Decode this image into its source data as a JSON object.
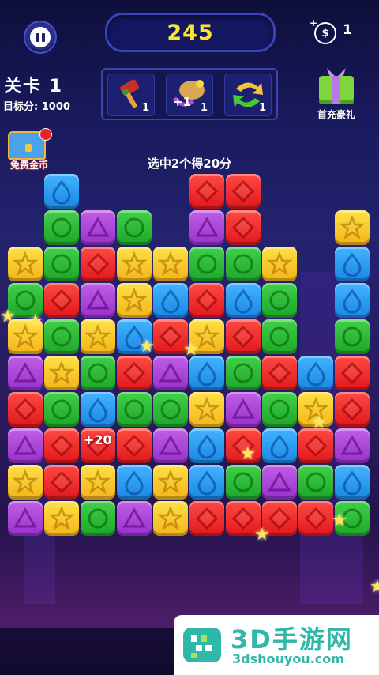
{
  "hud": {
    "score": "245",
    "coins": "1",
    "coin_symbol": "$",
    "coin_plus": "+",
    "level_label": "关卡 1",
    "target_label": "目标分: 1000",
    "hint_text": "选中2个得20分",
    "floating_points": "+20"
  },
  "tools": [
    {
      "name": "hammer-icon",
      "count": "1"
    },
    {
      "name": "plus-one-icon",
      "count": "1",
      "label": "+1"
    },
    {
      "name": "refresh-icon",
      "count": "1"
    }
  ],
  "side_buttons": {
    "gift_label": "首充豪礼",
    "free_coin_label": "免费金币"
  },
  "board": {
    "columns": 10,
    "rows": 10,
    "colors": {
      "red": "#e8241f",
      "green": "#2ab832",
      "purple": "#a840d6",
      "yellow": "#f8cc2a",
      "blue": "#2a9cf2"
    },
    "grid": [
      [
        "",
        "blue",
        "",
        "",
        "",
        "red",
        "red",
        "",
        "",
        ""
      ],
      [
        "",
        "green",
        "purple",
        "green",
        "",
        "purple",
        "red",
        "",
        "",
        "yellow"
      ],
      [
        "yellow",
        "green",
        "red",
        "yellow",
        "yellow",
        "green",
        "green",
        "yellow",
        "",
        "blue"
      ],
      [
        "green",
        "red",
        "purple",
        "yellow",
        "blue",
        "red",
        "blue",
        "green",
        "",
        "blue"
      ],
      [
        "yellow",
        "green",
        "yellow",
        "blue",
        "red",
        "yellow",
        "red",
        "green",
        "",
        "green"
      ],
      [
        "purple",
        "yellow",
        "green",
        "red",
        "purple",
        "blue",
        "green",
        "red",
        "blue",
        "red"
      ],
      [
        "red",
        "green",
        "blue",
        "green",
        "green",
        "yellow",
        "purple",
        "green",
        "yellow",
        "red"
      ],
      [
        "purple",
        "red",
        "red",
        "red",
        "purple",
        "blue",
        "red",
        "blue",
        "red",
        "purple"
      ],
      [
        "yellow",
        "red",
        "yellow",
        "blue",
        "yellow",
        "blue",
        "green",
        "purple",
        "green",
        "blue"
      ],
      [
        "purple",
        "yellow",
        "green",
        "purple",
        "yellow",
        "red",
        "red",
        "red",
        "red",
        "green"
      ]
    ]
  },
  "watermark": {
    "title": "3D手游网",
    "url": "3dshouyou.com"
  }
}
